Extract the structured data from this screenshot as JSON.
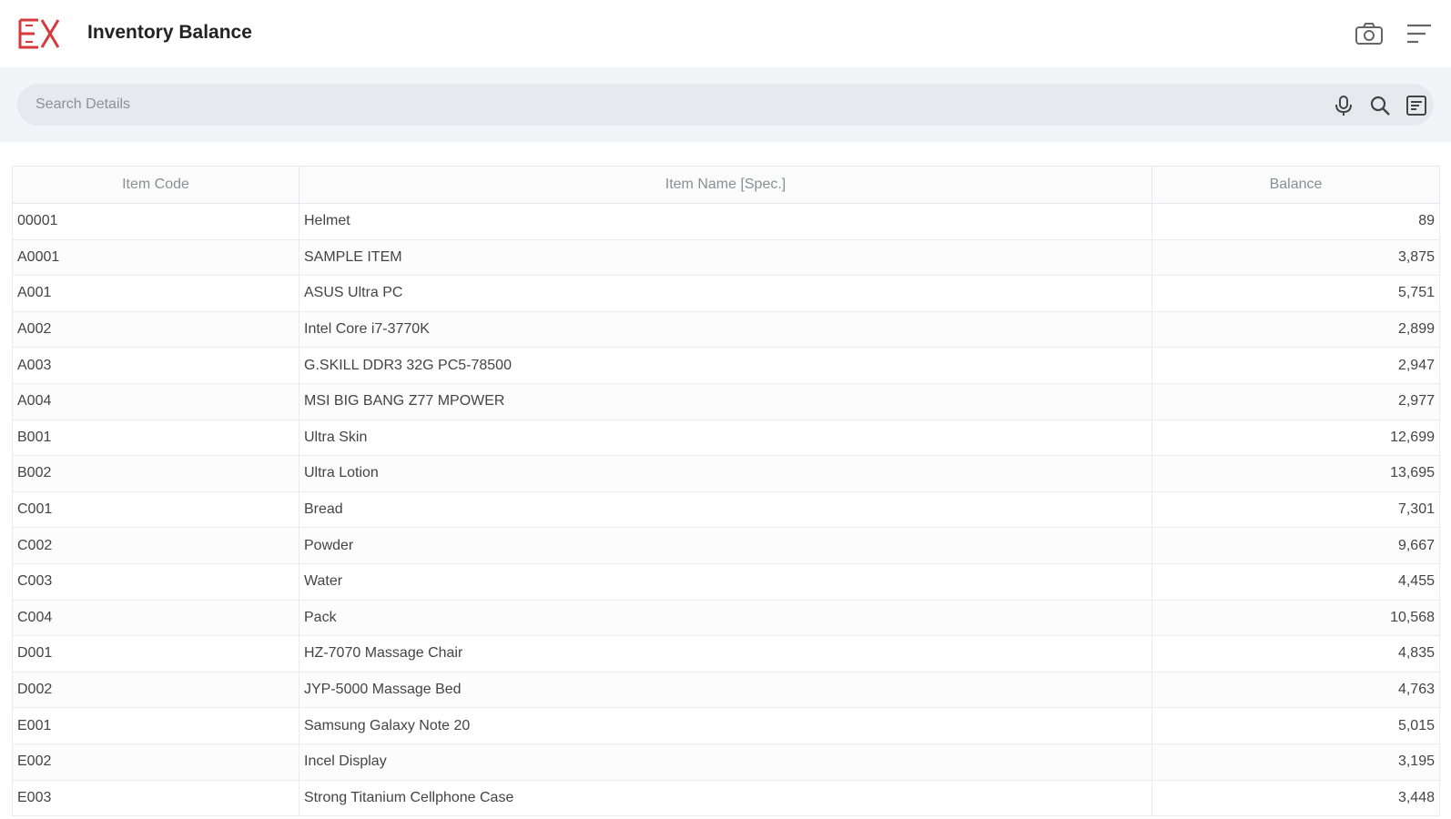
{
  "header": {
    "title": "Inventory Balance",
    "brand_color": "#d63a3a"
  },
  "search": {
    "placeholder": "Search Details"
  },
  "table": {
    "columns": [
      "Item Code",
      "Item Name [Spec.]",
      "Balance"
    ],
    "rows": [
      [
        "00001",
        "Helmet",
        "89"
      ],
      [
        "A0001",
        "SAMPLE ITEM",
        "3,875"
      ],
      [
        "A001",
        "ASUS Ultra PC",
        "5,751"
      ],
      [
        "A002",
        "Intel Core i7-3770K",
        "2,899"
      ],
      [
        "A003",
        "G.SKILL DDR3 32G PC5-78500",
        "2,947"
      ],
      [
        "A004",
        "MSI BIG BANG Z77 MPOWER",
        "2,977"
      ],
      [
        "B001",
        "Ultra Skin",
        "12,699"
      ],
      [
        "B002",
        "Ultra Lotion",
        "13,695"
      ],
      [
        "C001",
        "Bread",
        "7,301"
      ],
      [
        "C002",
        "Powder",
        "9,667"
      ],
      [
        "C003",
        "Water",
        "4,455"
      ],
      [
        "C004",
        "Pack",
        "10,568"
      ],
      [
        "D001",
        "HZ-7070 Massage Chair",
        "4,835"
      ],
      [
        "D002",
        "JYP-5000 Massage Bed",
        "4,763"
      ],
      [
        "E001",
        "Samsung Galaxy Note 20",
        "5,015"
      ],
      [
        "E002",
        "Incel Display",
        "3,195"
      ],
      [
        "E003",
        "Strong Titanium Cellphone Case",
        "3,448"
      ]
    ]
  }
}
